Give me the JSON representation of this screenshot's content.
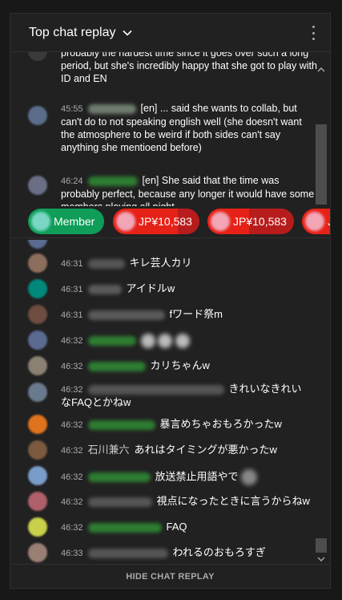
{
  "header": {
    "title": "Top chat replay",
    "chevron_icon": "chevron-down-icon",
    "menu_icon": "more-vert-icon"
  },
  "pinned_messages": [
    {
      "timestamp": "",
      "author": "",
      "text": "probably the hardest time since it goes over such a long period, but she's incredibly happy that she got to play with ID and EN",
      "avatar_color": "#2b2b2b"
    },
    {
      "timestamp": "45:55",
      "author_blurred": true,
      "text": "[en] ... said she wants to collab, but can't do to not speaking english well (she doesn't want the atmosphere to be weird if both sides can't say anything she mentioend before)",
      "avatar_color": "#5b6d8a"
    },
    {
      "timestamp": "46:24",
      "author_blurred": true,
      "text": "[en] She said that the time was probably perfect, because any longer it would have some members playing all night",
      "avatar_color": "#6a6f86"
    }
  ],
  "ticker": [
    {
      "type": "member",
      "label": "Member",
      "color": "#0f9d58",
      "avatar_color": "#7ad7c5"
    },
    {
      "type": "paid",
      "label": "JP¥10,583",
      "color": "#e62117",
      "progress": 0.75,
      "avatar_color": "#f1a5b5"
    },
    {
      "type": "paid",
      "label": "JP¥10,583",
      "color": "#e62117",
      "progress": 0.48,
      "avatar_color": "#f1a5b5"
    },
    {
      "type": "paid",
      "label": "J",
      "color": "#e62117",
      "progress": 0.9,
      "avatar_color": "#f1a5b5"
    }
  ],
  "chat_messages": [
    {
      "timestamp": "46:31",
      "author": "",
      "text": "キレ芸人カリ",
      "avatar_color": "#8d6e5c"
    },
    {
      "timestamp": "46:31",
      "author": "",
      "text": "アイドルw",
      "avatar_color": "#00897b"
    },
    {
      "timestamp": "46:31",
      "author": "",
      "text": "fワード祭m",
      "avatar_color": "#6d4c41"
    },
    {
      "timestamp": "46:32",
      "author": "",
      "text": "",
      "avatar_color": "#5a6b8f"
    },
    {
      "timestamp": "46:32",
      "author": "",
      "text": "カリちゃんw",
      "avatar_color": "#8a8173"
    },
    {
      "timestamp": "46:32",
      "author": "",
      "text": "きれいなきれいなFAQとかねw",
      "avatar_color": "#6a7a8e"
    },
    {
      "timestamp": "46:32",
      "author": "",
      "text": "暴言めちゃおもろかったw",
      "avatar_color": "#e0731e"
    },
    {
      "timestamp": "46:32",
      "author": "石川兼六",
      "text": "あれはタイミングが悪かったw",
      "avatar_color": "#7b5a3f"
    },
    {
      "timestamp": "46:32",
      "author": "",
      "text": "放送禁止用語やで",
      "avatar_color": "#7a9cc9"
    },
    {
      "timestamp": "46:32",
      "author": "",
      "text": "視点になったときに言うからねw",
      "avatar_color": "#b0606a"
    },
    {
      "timestamp": "46:32",
      "author": "",
      "text": "FAQ",
      "avatar_color": "#c9d04a"
    },
    {
      "timestamp": "46:33",
      "author": "",
      "text": "われるのおもろすぎ",
      "avatar_color": "#9a8074"
    }
  ],
  "footer": {
    "hide_label": "HIDE CHAT REPLAY"
  }
}
